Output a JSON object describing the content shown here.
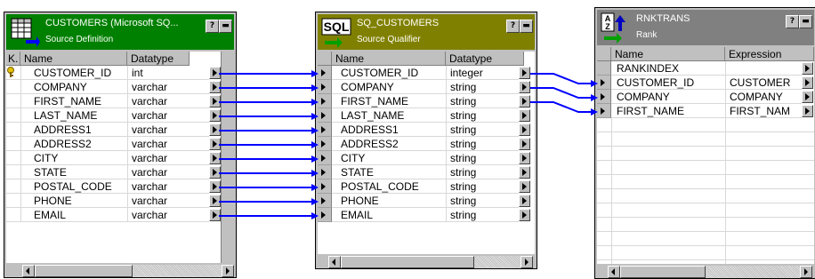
{
  "colors": {
    "source_title": "#008000",
    "qualifier_title": "#808000",
    "rank_title": "#808080",
    "link": "#0000ff"
  },
  "source_definition": {
    "title": "CUSTOMERS (Microsoft SQ...",
    "subtitle": "Source Definition",
    "columns": [
      "K.",
      "Name",
      "Datatype"
    ],
    "rows": [
      {
        "name": "CUSTOMER_ID",
        "type": "int",
        "key": true
      },
      {
        "name": "COMPANY",
        "type": "varchar"
      },
      {
        "name": "FIRST_NAME",
        "type": "varchar"
      },
      {
        "name": "LAST_NAME",
        "type": "varchar"
      },
      {
        "name": "ADDRESS1",
        "type": "varchar"
      },
      {
        "name": "ADDRESS2",
        "type": "varchar"
      },
      {
        "name": "CITY",
        "type": "varchar"
      },
      {
        "name": "STATE",
        "type": "varchar"
      },
      {
        "name": "POSTAL_CODE",
        "type": "varchar"
      },
      {
        "name": "PHONE",
        "type": "varchar"
      },
      {
        "name": "EMAIL",
        "type": "varchar"
      }
    ]
  },
  "source_qualifier": {
    "title": "SQ_CUSTOMERS",
    "subtitle": "Source Qualifier",
    "icon_text": "SQL",
    "columns": [
      "Name",
      "Datatype"
    ],
    "rows": [
      {
        "name": "CUSTOMER_ID",
        "type": "integer"
      },
      {
        "name": "COMPANY",
        "type": "string"
      },
      {
        "name": "FIRST_NAME",
        "type": "string"
      },
      {
        "name": "LAST_NAME",
        "type": "string"
      },
      {
        "name": "ADDRESS1",
        "type": "string"
      },
      {
        "name": "ADDRESS2",
        "type": "string"
      },
      {
        "name": "CITY",
        "type": "string"
      },
      {
        "name": "STATE",
        "type": "string"
      },
      {
        "name": "POSTAL_CODE",
        "type": "string"
      },
      {
        "name": "PHONE",
        "type": "string"
      },
      {
        "name": "EMAIL",
        "type": "string"
      }
    ]
  },
  "rank": {
    "title": "RNKTRANS",
    "subtitle": "Rank",
    "icon_text": "AZ",
    "columns": [
      "Name",
      "Expression"
    ],
    "rows": [
      {
        "name": "RANKINDEX",
        "expr": ""
      },
      {
        "name": "CUSTOMER_ID",
        "expr": "CUSTOMER"
      },
      {
        "name": "COMPANY",
        "expr": "COMPANY"
      },
      {
        "name": "FIRST_NAME",
        "expr": "FIRST_NAM"
      }
    ]
  },
  "window_buttons": {
    "help": "?",
    "minimize": "▬"
  }
}
